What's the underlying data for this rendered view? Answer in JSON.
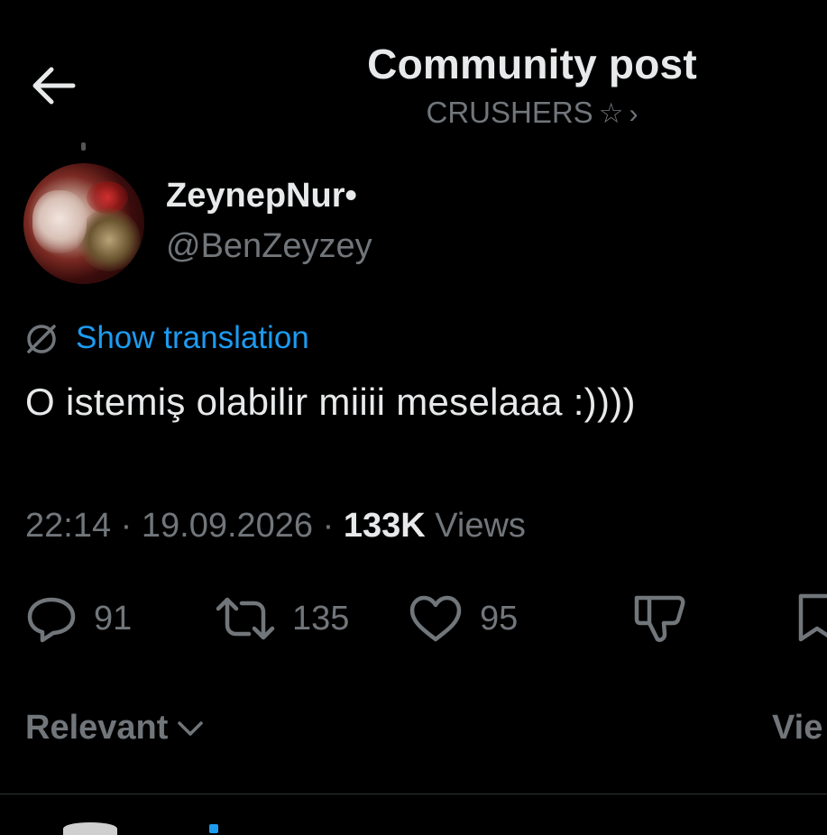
{
  "header": {
    "title": "Community post",
    "community": "CRUSHERS",
    "community_star": "☆",
    "community_chevron": "›"
  },
  "author": {
    "display_name": "ZeynepNur•",
    "handle": "@BenZeyzey"
  },
  "translation": {
    "link_label": "Show translation"
  },
  "post": {
    "text": "O istemiş olabilir miiii meselaaa :))))"
  },
  "meta": {
    "time": "22:14",
    "separator": "·",
    "date": "19.09.2026",
    "views_count": "133K",
    "views_label": "Views"
  },
  "actions": {
    "replies": "91",
    "reposts": "135",
    "likes": "95"
  },
  "sort": {
    "label": "Relevant",
    "view_label": "Vie"
  },
  "colors": {
    "background": "#000000",
    "primary_text": "#e7e9ea",
    "secondary_text": "#71767b",
    "link": "#1d9bf0",
    "divider": "#2f3336"
  },
  "icons": [
    "back-arrow-icon",
    "star-icon",
    "chevron-right-icon",
    "translate-globe-icon",
    "reply-icon",
    "repost-icon",
    "like-icon",
    "dislike-icon",
    "bookmark-icon",
    "chevron-down-icon"
  ]
}
